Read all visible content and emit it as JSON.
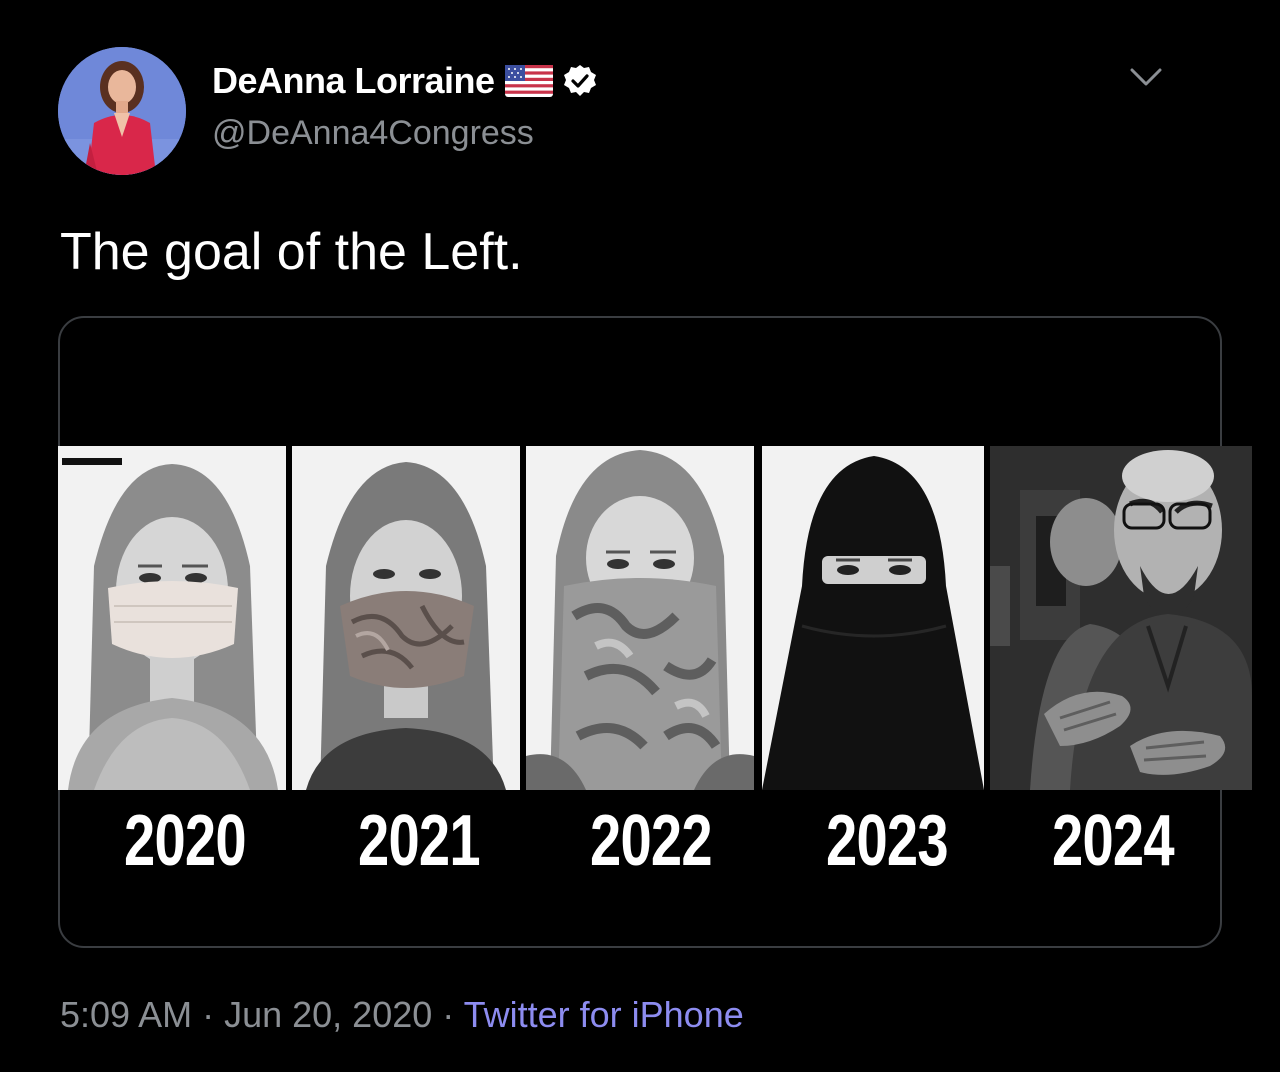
{
  "tweet": {
    "display_name": "DeAnna Lorraine",
    "handle": "@DeAnna4Congress",
    "text": "The goal of the Left.",
    "icons": {
      "flag": "us-flag-icon",
      "verified": "verified-badge-icon",
      "menu": "chevron-down-icon"
    },
    "media": {
      "years": [
        "2020",
        "2021",
        "2022",
        "2023",
        "2024"
      ]
    },
    "time": "5:09 AM",
    "separator": " · ",
    "date": "Jun 20, 2020",
    "source": "Twitter for iPhone"
  },
  "colors": {
    "background": "#000000",
    "muted_text": "#8b8f94",
    "source_link": "#8d8cf0",
    "verified_badge": "#ffffff"
  }
}
